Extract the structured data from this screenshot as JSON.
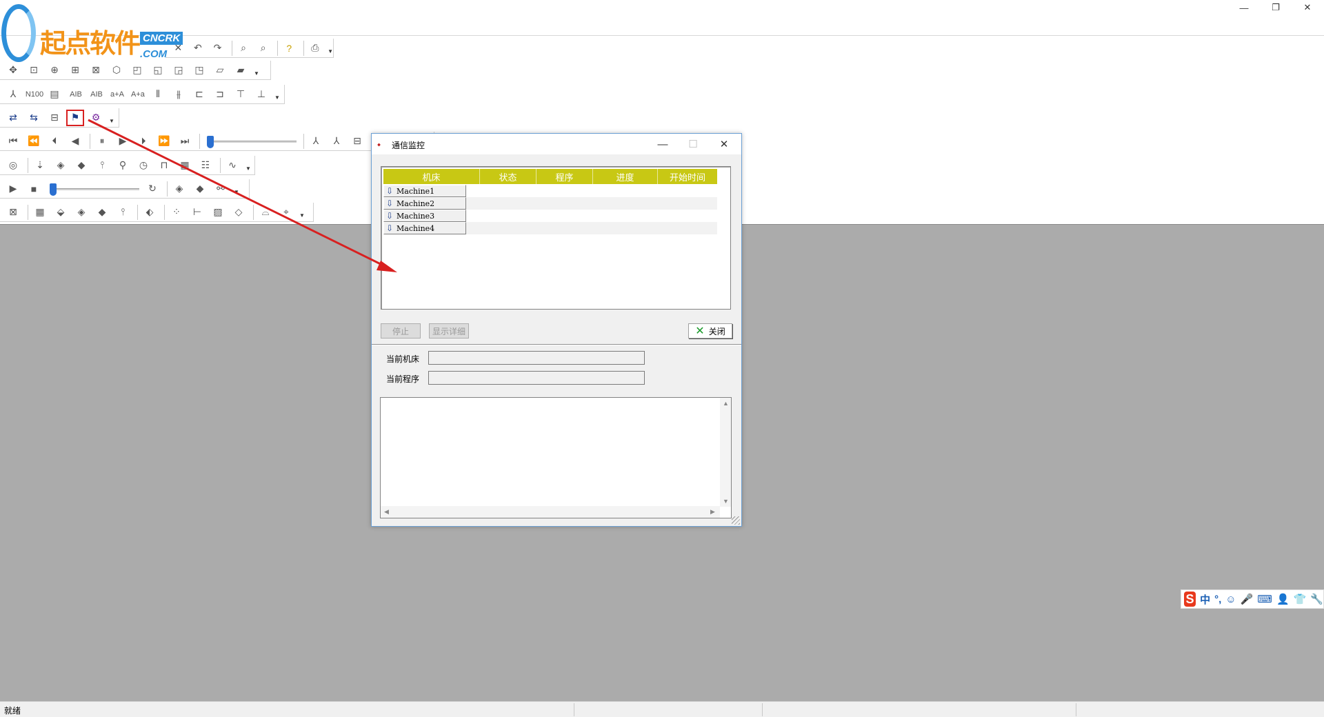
{
  "window": {
    "minimize_glyph": "—",
    "restore_glyph": "❐",
    "close_glyph": "✕"
  },
  "logo": {
    "text": "起点软件",
    "badge": "CNCRK",
    "suffix": ".COM"
  },
  "toolbar_text": {
    "n100": "N100",
    "aib1": "AIB",
    "aib2": "AIB",
    "ata": "a+A",
    "ata2": "A+a"
  },
  "dialog": {
    "title": "通信监控",
    "columns": [
      "机床",
      "状态",
      "程序",
      "进度",
      "开始时间"
    ],
    "machines": [
      "Machine1",
      "Machine2",
      "Machine3",
      "Machine4"
    ],
    "stop_label": "停止",
    "details_label": "显示详细",
    "close_label": "关闭",
    "current_machine_label": "当前机床",
    "current_program_label": "当前程序"
  },
  "statusbar": {
    "text": "就绪"
  },
  "ime": {
    "logo": "S",
    "items": [
      "中",
      "°,",
      "☺",
      "🎤",
      "⌨",
      "👤",
      "👕",
      "🔧"
    ]
  },
  "colors": {
    "grid_header": "#c8c814",
    "workspace": "#ababab",
    "annotation": "#d82020",
    "accent": "#2a6fd0"
  }
}
